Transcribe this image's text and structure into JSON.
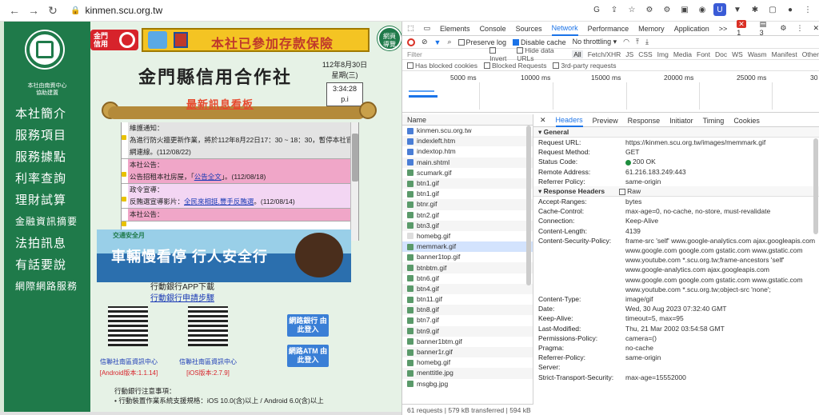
{
  "browser": {
    "url": "kinmen.scu.org.tw"
  },
  "sidebar": {
    "subtitle": "本社由南資中心\n協助建置",
    "items": [
      "本社簡介",
      "服務項目",
      "服務據點",
      "利率查詢",
      "理財試算",
      "金融資訊摘要",
      "法拍訊息",
      "有話要說",
      "網際網路服務"
    ]
  },
  "banner": {
    "logo_text": "金門\n信用",
    "insurance": "本社已參加存款保險",
    "right_badge": "網頁\n導覽"
  },
  "header": {
    "title": "金門縣信用合作社",
    "date": "112年8月30日",
    "weekday": "星期(三)",
    "time": "3:34:28 p.i"
  },
  "news": {
    "title": "最新訊息看板",
    "items": [
      {
        "head": "維護通知：",
        "text": "為進行防火牆更新作業，將於112年8月22日17：30 ~ 18：30，暫停本社官網連線。(112/08/22)",
        "link": ""
      },
      {
        "head": "本社公告：",
        "text": "公告招租本社房屋，「",
        "link": "公告全文",
        "tail": "」。(112/08/18)"
      },
      {
        "head": "政令宣導：",
        "text": "反賄選宣導影片：",
        "link": "全民來相挺,豐手反賄選",
        "tail": "。(112/08/14)"
      },
      {
        "head": "本社公告：",
        "text": "",
        "link": ""
      }
    ]
  },
  "ad": {
    "top": "交通安全月",
    "text": "車輛慢看停 行人安全行"
  },
  "app": {
    "title": "行動銀行APP下載",
    "link": "行動銀行申請步驟",
    "q1_label": "信聯社南區資訊中心",
    "q1_ver": "[Android版本:1.1.14]",
    "q2_label": "信聯社南區資訊中心",
    "q2_ver": "[iOS版本:2.7.9]",
    "btn_net": "網路銀行\n由此登入",
    "btn_atm": "網路ATM\n由此登入",
    "notes_title": "行動銀行注意事項：",
    "notes_1": "• 行動裝置作業系統支援規格：iOS 10.0(含)以上 / Android 6.0(含)以上"
  },
  "devtools": {
    "tabs": [
      "Elements",
      "Console",
      "Sources",
      "Network",
      "Performance",
      "Memory",
      "Application",
      ">>"
    ],
    "active_tab": "Network",
    "error_count": "1",
    "msg_count": "3",
    "toolbar": {
      "preserve": "Preserve log",
      "disable_cache": "Disable cache",
      "throttle": "No throttling"
    },
    "filter": {
      "placeholder": "Filter",
      "invert": "Invert",
      "hide": "Hide data URLs",
      "types": [
        "All",
        "Fetch/XHR",
        "JS",
        "CSS",
        "Img",
        "Media",
        "Font",
        "Doc",
        "WS",
        "Wasm",
        "Manifest",
        "Other"
      ]
    },
    "checks": [
      "Has blocked cookies",
      "Blocked Requests",
      "3rd-party requests"
    ],
    "timeline": [
      "5000 ms",
      "10000 ms",
      "15000 ms",
      "20000 ms",
      "25000 ms",
      "30"
    ],
    "files_header": "Name",
    "files": [
      "kinmen.scu.org.tw",
      "indexleft.htm",
      "indextop.htm",
      "main.shtml",
      "scumark.gif",
      "btn1.gif",
      "btn1.gif",
      "btnr.gif",
      "btn2.gif",
      "btn3.gif",
      "homebg.gif",
      "memmark.gif",
      "banner1top.gif",
      "btnbtm.gif",
      "btn6.gif",
      "btn4.gif",
      "btn11.gif",
      "btn8.gif",
      "btn7.gif",
      "btn9.gif",
      "banner1btm.gif",
      "banner1r.gif",
      "homebg.gif",
      "menttitle.jpg",
      "msgbg.jpg"
    ],
    "footer": "61 requests | 579 kB transferred | 594 kB",
    "detail_tabs": [
      "Headers",
      "Preview",
      "Response",
      "Initiator",
      "Timing",
      "Cookies"
    ],
    "general_title": "▾ General",
    "general": [
      {
        "k": "Request URL:",
        "v": "https://kinmen.scu.org.tw/images/memmark.gif"
      },
      {
        "k": "Request Method:",
        "v": "GET"
      },
      {
        "k": "Status Code:",
        "v": "200 OK"
      },
      {
        "k": "Remote Address:",
        "v": "61.216.183.249:443"
      },
      {
        "k": "Referrer Policy:",
        "v": "same-origin"
      }
    ],
    "resp_title": "▾ Response Headers",
    "raw": "Raw",
    "response": [
      {
        "k": "Accept-Ranges:",
        "v": "bytes"
      },
      {
        "k": "Cache-Control:",
        "v": "max-age=0, no-cache, no-store, must-revalidate"
      },
      {
        "k": "Connection:",
        "v": "Keep-Alive"
      },
      {
        "k": "Content-Length:",
        "v": "4139"
      },
      {
        "k": "Content-Security-Policy:",
        "v": "frame-src 'self' www.google-analytics.com ajax.googleapis.com www.google.com google.com gstatic.com www.gstatic.com www.youtube.com *.scu.org.tw;frame-ancestors 'self' www.google-analytics.com ajax.googleapis.com www.google.com google.com gstatic.com www.gstatic.com www.youtube.com *.scu.org.tw;object-src 'none';"
      },
      {
        "k": "Content-Type:",
        "v": "image/gif"
      },
      {
        "k": "Date:",
        "v": "Wed, 30 Aug 2023 07:32:40 GMT"
      },
      {
        "k": "Keep-Alive:",
        "v": "timeout=5, max=95"
      },
      {
        "k": "Last-Modified:",
        "v": "Thu, 21 Mar 2002 03:54:58 GMT"
      },
      {
        "k": "Permissions-Policy:",
        "v": "camera=()"
      },
      {
        "k": "Pragma:",
        "v": "no-cache"
      },
      {
        "k": "Referrer-Policy:",
        "v": "same-origin"
      },
      {
        "k": "Server:",
        "v": ""
      },
      {
        "k": "Strict-Transport-Security:",
        "v": "max-age=15552000"
      }
    ]
  }
}
